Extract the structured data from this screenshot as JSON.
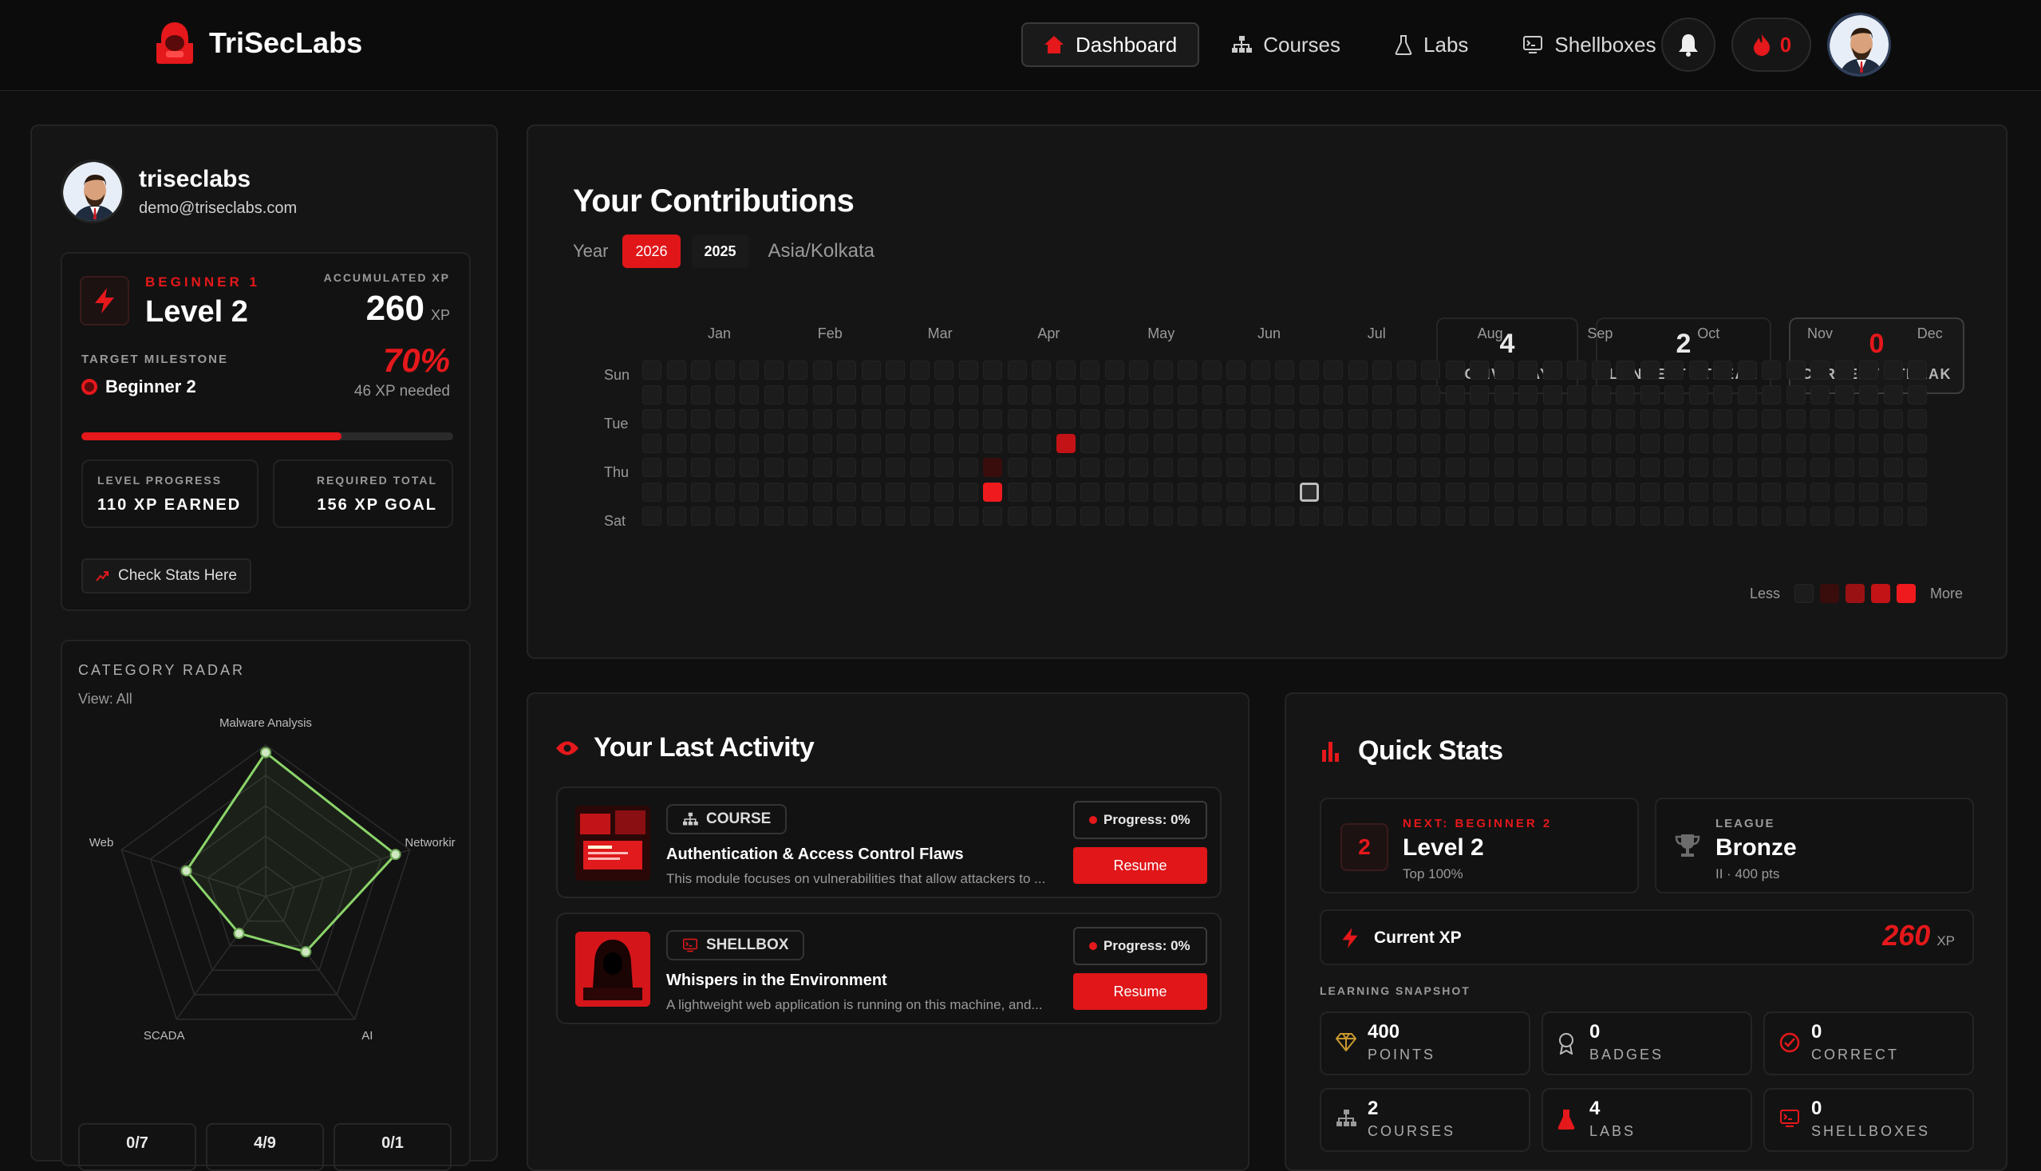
{
  "app": {
    "name": "TriSecLabs"
  },
  "nav": {
    "items": [
      {
        "label": "Dashboard",
        "icon": "home-icon"
      },
      {
        "label": "Courses",
        "icon": "sitemap-icon"
      },
      {
        "label": "Labs",
        "icon": "flask-icon"
      },
      {
        "label": "Shellboxes",
        "icon": "terminal-icon"
      }
    ],
    "streak_count": "0"
  },
  "profile": {
    "username": "triseclabs",
    "email": "demo@triseclabs.com",
    "rank_label": "BEGINNER 1",
    "level": "Level 2",
    "xp_label": "ACCUMULATED XP",
    "xp_value": "260",
    "xp_unit": "XP",
    "milestone_label": "TARGET MILESTONE",
    "milestone": "Beginner 2",
    "milestone_percent": "70%",
    "xp_needed": "46 XP needed",
    "progress_fraction": 0.7,
    "level_progress_label": "LEVEL PROGRESS",
    "level_progress_value": "110 XP EARNED",
    "required_total_label": "REQUIRED TOTAL",
    "required_total_value": "156 XP GOAL",
    "check_stats": "Check Stats Here"
  },
  "radar": {
    "title": "CATEGORY RADAR",
    "view": "View: All",
    "axes": [
      "Malware Analysis",
      "Networkir",
      "AI",
      "SCADA",
      "Web"
    ],
    "values": [
      0.95,
      0.9,
      0.45,
      0.3,
      0.55
    ],
    "footer": [
      "0/7",
      "4/9",
      "0/1"
    ]
  },
  "contributions": {
    "title": "Your Contributions",
    "year_label": "Year",
    "years": [
      "2026",
      "2025"
    ],
    "selected_year": "2026",
    "timezone": "Asia/Kolkata",
    "stats": [
      {
        "value": "4",
        "label": "ACTIVE DAYS"
      },
      {
        "value": "2",
        "label": "LONGEST STREAK"
      },
      {
        "value": "0",
        "label": "CURRENT STREAK"
      }
    ],
    "months": [
      "Jan",
      "Feb",
      "Mar",
      "Apr",
      "May",
      "Jun",
      "Jul",
      "Aug",
      "Sep",
      "Oct",
      "Nov",
      "Dec"
    ],
    "days": [
      "Sun",
      "Tue",
      "Thu",
      "Sat"
    ],
    "active_cells": [
      {
        "week": 17,
        "day": 3,
        "level": 3
      },
      {
        "week": 14,
        "day": 5,
        "level": 4
      },
      {
        "week": 14,
        "day": 4,
        "level": 1
      }
    ],
    "today_cell": {
      "week": 27,
      "day": 5
    },
    "legend_less": "Less",
    "legend_more": "More"
  },
  "activity": {
    "title": "Your Last Activity",
    "items": [
      {
        "type": "COURSE",
        "title": "Authentication & Access Control Flaws",
        "desc": "This module focuses on vulnerabilities that allow attackers to ...",
        "progress": "Progress: 0%",
        "action": "Resume"
      },
      {
        "type": "SHELLBOX",
        "title": "Whispers in the Environment",
        "desc": "A lightweight web application is running on this machine, and...",
        "progress": "Progress: 0%",
        "action": "Resume"
      }
    ]
  },
  "quick_stats": {
    "title": "Quick Stats",
    "next_label": "NEXT: BEGINNER 2",
    "next_level": "Level 2",
    "next_sub": "Top 100%",
    "next_num": "2",
    "league_label": "LEAGUE",
    "league": "Bronze",
    "league_sub": "II · 400 pts",
    "current_xp_label": "Current XP",
    "current_xp": "260",
    "current_xp_unit": "XP",
    "snapshot_label": "LEARNING SNAPSHOT",
    "snapshot": [
      {
        "value": "400",
        "label": "POINTS",
        "icon": "diamond-icon"
      },
      {
        "value": "0",
        "label": "BADGES",
        "icon": "badge-icon"
      },
      {
        "value": "0",
        "label": "CORRECT",
        "icon": "check-circle-icon"
      },
      {
        "value": "2",
        "label": "COURSES",
        "icon": "sitemap-icon"
      },
      {
        "value": "4",
        "label": "LABS",
        "icon": "flask-icon"
      },
      {
        "value": "0",
        "label": "SHELLBOXES",
        "icon": "terminal-icon"
      }
    ]
  },
  "colors": {
    "accent": "#e5181b",
    "background": "#0f0f0f",
    "panel": "#151515",
    "radar": "#8bd46a"
  }
}
